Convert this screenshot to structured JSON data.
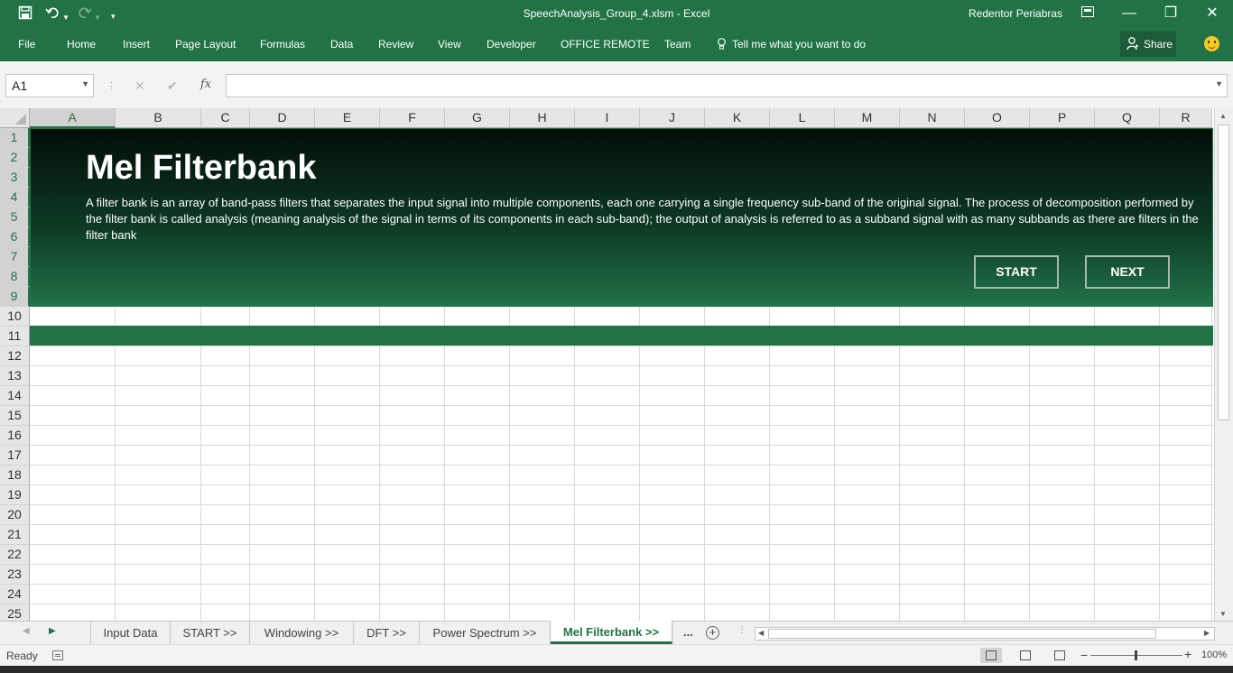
{
  "titlebar": {
    "document_title": "SpeechAnalysis_Group_4.xlsm  -  Excel",
    "user_name": "Redentor Periabras"
  },
  "ribbon": {
    "tabs": [
      "File",
      "Home",
      "Insert",
      "Page Layout",
      "Formulas",
      "Data",
      "Review",
      "View",
      "Developer",
      "OFFICE REMOTE",
      "Team"
    ],
    "tell_me": "Tell me what you want to do",
    "share": "Share"
  },
  "formula_bar": {
    "name_box": "A1",
    "fx_label": "fx",
    "formula": ""
  },
  "grid": {
    "columns": [
      "A",
      "B",
      "C",
      "D",
      "E",
      "F",
      "G",
      "H",
      "I",
      "J",
      "K",
      "L",
      "M",
      "N",
      "O",
      "P",
      "Q",
      "R"
    ],
    "rows": [
      "1",
      "2",
      "3",
      "4",
      "5",
      "6",
      "7",
      "8",
      "9",
      "10",
      "11",
      "12",
      "13",
      "14",
      "15",
      "16",
      "17",
      "18",
      "19",
      "20",
      "21",
      "22",
      "23",
      "24",
      "25"
    ]
  },
  "banner": {
    "title": "Mel Filterbank",
    "description": "A filter bank is an array of band-pass filters that separates the input signal into multiple components, each one carrying a single frequency sub-band of the original signal. The process of decomposition performed by the filter bank is called analysis (meaning analysis of the signal in terms of its components in each sub-band); the output of analysis is referred to as a subband signal with as many subbands as there are filters in the filter bank",
    "start_label": "START",
    "next_label": "NEXT"
  },
  "sheet_tabs": {
    "tabs": [
      "Input Data",
      "START >>",
      "Windowing >>",
      "DFT >>",
      "Power Spectrum >>",
      "Mel Filterbank >>"
    ],
    "active": "Mel Filterbank >>",
    "ellipsis": "..."
  },
  "status": {
    "ready": "Ready",
    "zoom": "100%"
  },
  "colors": {
    "excel_green": "#217346",
    "banner_dark": "#020d08"
  }
}
